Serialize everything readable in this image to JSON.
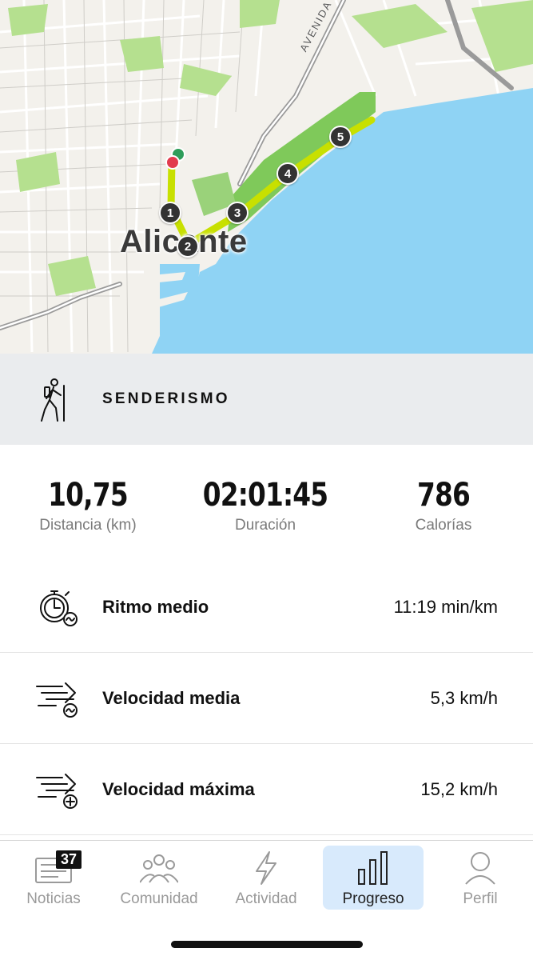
{
  "map": {
    "city": "Alicante",
    "street": "AVENIDA DE DE",
    "markers": [
      "1",
      "2",
      "3",
      "4",
      "5"
    ]
  },
  "activity": {
    "icon": "hiking-person-icon",
    "name": "SENDERISMO"
  },
  "summary": {
    "distance": {
      "value": "10,75",
      "label": "Distancia (km)"
    },
    "duration": {
      "value": "02:01:45",
      "label": "Duración"
    },
    "calories": {
      "value": "786",
      "label": "Calorías"
    }
  },
  "metrics": [
    {
      "icon": "stopwatch-pace-icon",
      "label": "Ritmo medio",
      "value": "11:19 min/km"
    },
    {
      "icon": "speed-average-icon",
      "label": "Velocidad media",
      "value": "5,3 km/h"
    },
    {
      "icon": "speed-max-icon",
      "label": "Velocidad máxima",
      "value": "15,2 km/h"
    }
  ],
  "nav": {
    "items": [
      {
        "label": "Noticias",
        "icon": "news-icon",
        "badge": "37"
      },
      {
        "label": "Comunidad",
        "icon": "community-icon"
      },
      {
        "label": "Actividad",
        "icon": "lightning-icon"
      },
      {
        "label": "Progreso",
        "icon": "bar-chart-icon",
        "active": true
      },
      {
        "label": "Perfil",
        "icon": "profile-icon"
      }
    ]
  },
  "colors": {
    "route": "#c8e000",
    "sea": "#8fd3f4",
    "park": "#b5e08f",
    "active_tab_bg": "#d8eafc"
  }
}
